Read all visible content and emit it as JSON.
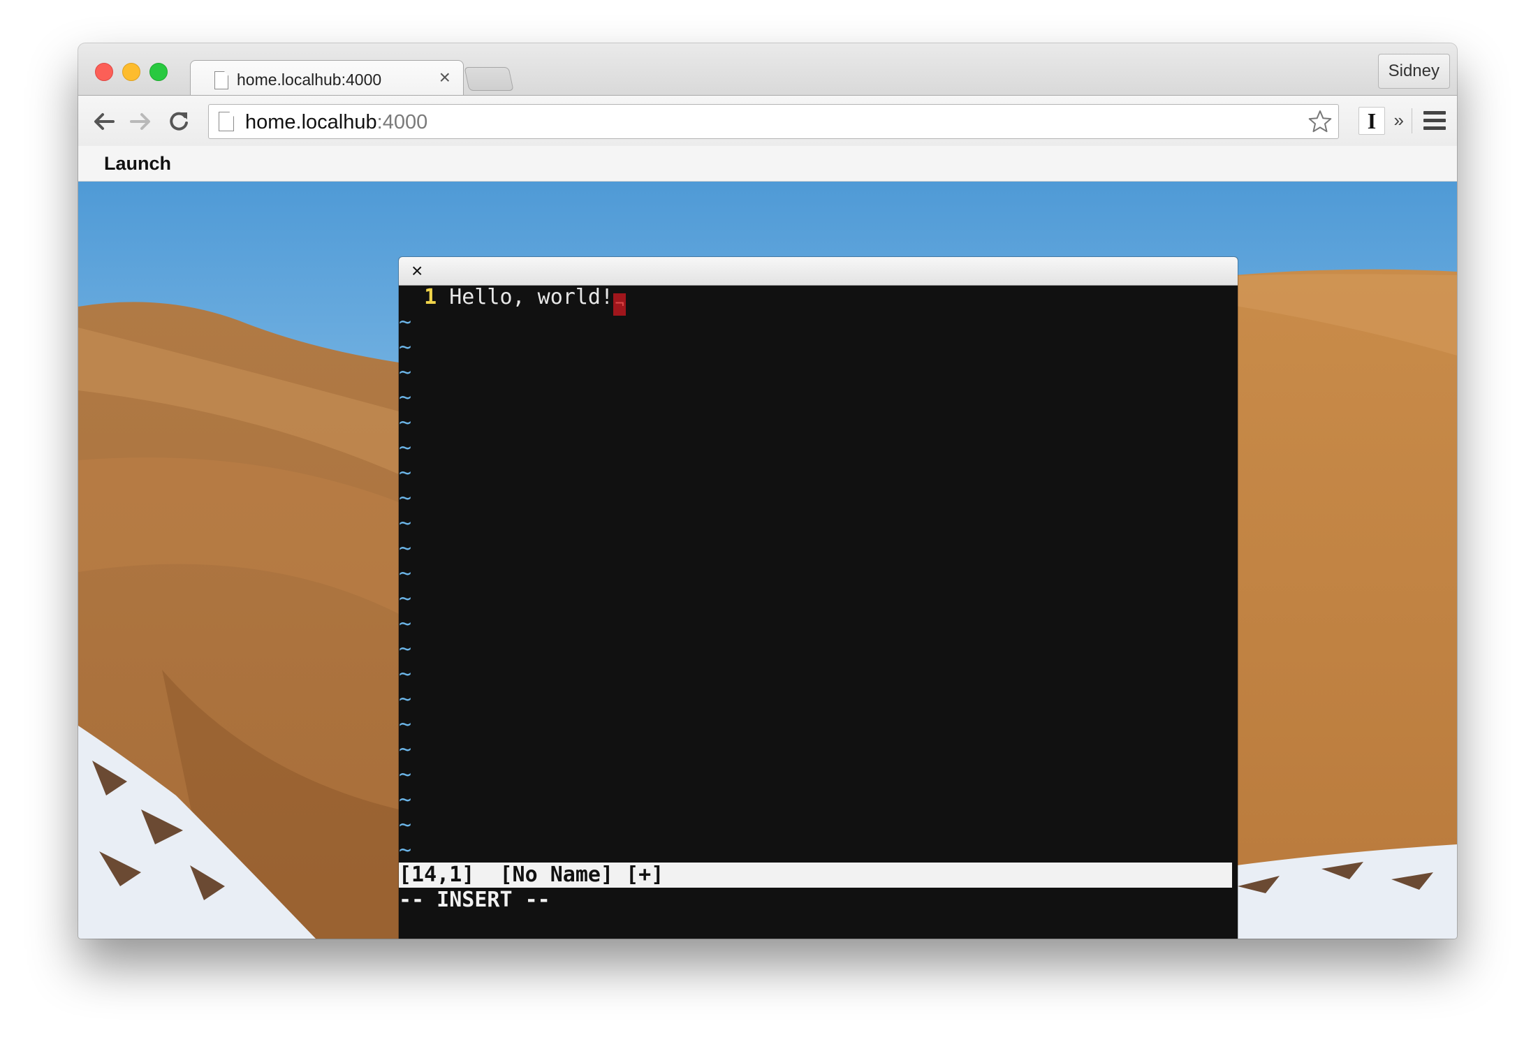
{
  "browser": {
    "tab_title": "home.localhub:4000",
    "tab_close_glyph": "×",
    "profile_name": "Sidney",
    "url_host": "home.localhub",
    "url_port": ":4000",
    "extension_glyph": "I",
    "overflow_glyph": "»"
  },
  "app": {
    "launch_label": "Launch"
  },
  "terminal": {
    "close_glyph": "×",
    "line_number": "1",
    "line_text": " Hello, world!",
    "cursor_glyph": "¬",
    "tilde_glyph": "~",
    "status_line": "[14,1]  [No Name] [+]",
    "mode_line": "-- INSERT --"
  },
  "colors": {
    "line_number": "#f0d44a",
    "tilde": "#6cb5e8",
    "cursor": "#a0161c",
    "terminal_bg": "#111111"
  },
  "icons": [
    "back-arrow-icon",
    "forward-arrow-icon",
    "reload-icon",
    "page-icon",
    "star-icon",
    "menu-icon",
    "close-icon"
  ]
}
